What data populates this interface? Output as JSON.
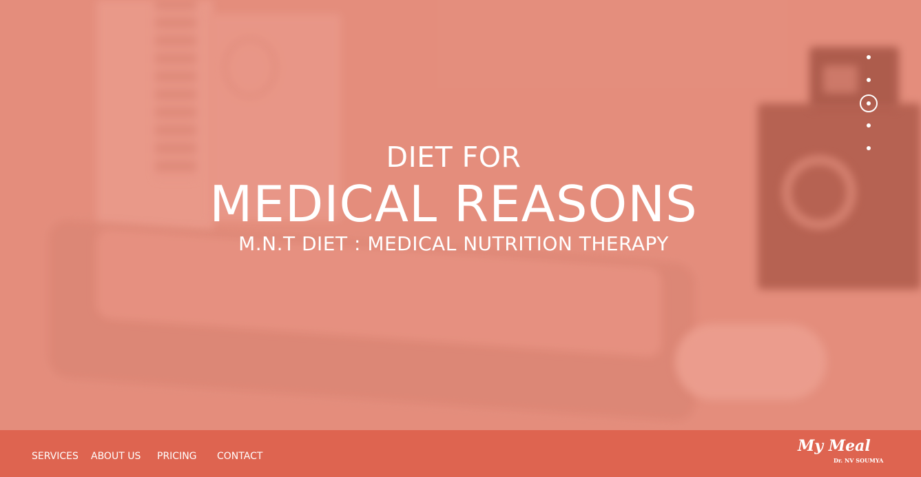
{
  "hero": {
    "title_small": "DIET FOR",
    "title_big": "MEDICAL REASONS",
    "subtitle": "M.N.T DIET : MEDICAL NUTRITION THERAPY",
    "overlay_color": "#e39585"
  },
  "slider": {
    "total": 5,
    "active_index": 2
  },
  "nav": {
    "items": [
      {
        "label": "SERVICES"
      },
      {
        "label": "ABOUT US"
      },
      {
        "label": "PRICING"
      },
      {
        "label": "CONTACT"
      }
    ],
    "background": "#de6450"
  },
  "logo": {
    "name": "My Meal",
    "tagline": "Dr. NV SOUMYA"
  }
}
